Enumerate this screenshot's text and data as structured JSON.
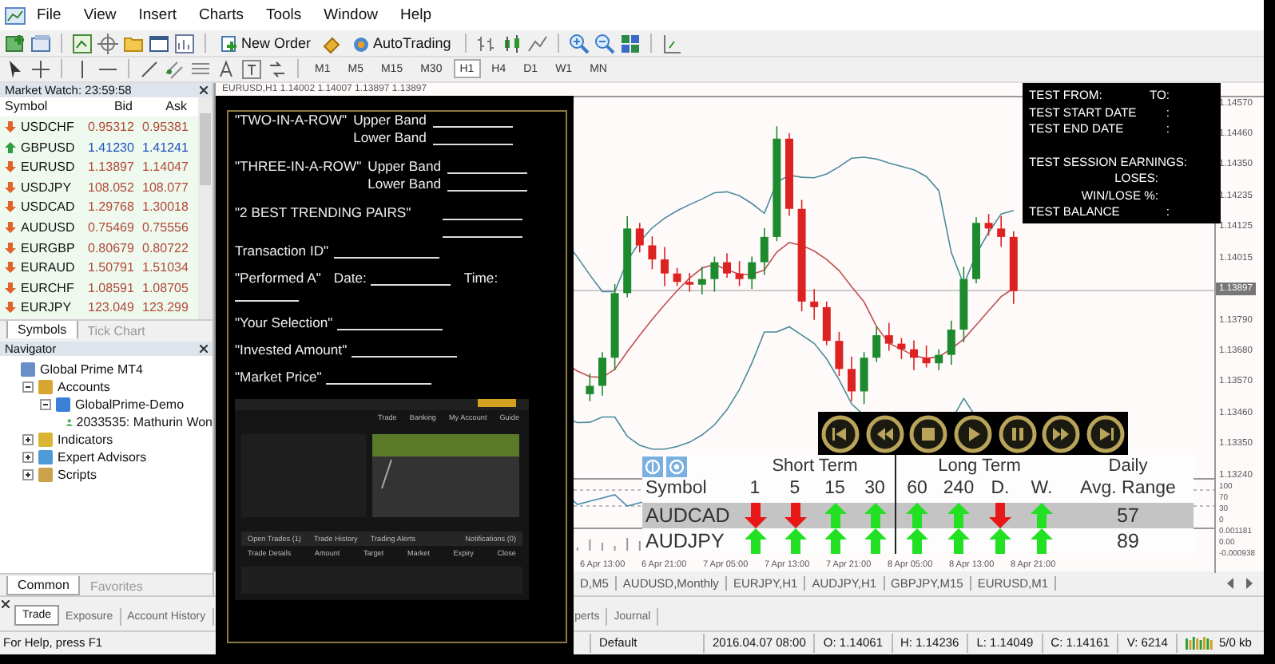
{
  "menu": {
    "items": [
      "File",
      "View",
      "Insert",
      "Charts",
      "Tools",
      "Window",
      "Help"
    ]
  },
  "toolbar": {
    "new_order": "New Order",
    "auto_trading": "AutoTrading",
    "timeframes": [
      {
        "label": "M1",
        "selected": false
      },
      {
        "label": "M5",
        "selected": false
      },
      {
        "label": "M15",
        "selected": false
      },
      {
        "label": "M30",
        "selected": false
      },
      {
        "label": "H1",
        "selected": true
      },
      {
        "label": "H4",
        "selected": false
      },
      {
        "label": "D1",
        "selected": false
      },
      {
        "label": "W1",
        "selected": false
      },
      {
        "label": "MN",
        "selected": false
      }
    ]
  },
  "market_watch": {
    "title": "Market Watch: 23:59:58",
    "columns": [
      "Symbol",
      "Bid",
      "Ask"
    ],
    "rows": [
      {
        "symbol": "USDCHF",
        "bid": "0.95312",
        "ask": "0.95381",
        "rising": false
      },
      {
        "symbol": "GBPUSD",
        "bid": "1.41230",
        "ask": "1.41241",
        "rising": true
      },
      {
        "symbol": "EURUSD",
        "bid": "1.13897",
        "ask": "1.14047",
        "rising": false
      },
      {
        "symbol": "USDJPY",
        "bid": "108.052",
        "ask": "108.077",
        "rising": false
      },
      {
        "symbol": "USDCAD",
        "bid": "1.29768",
        "ask": "1.30018",
        "rising": false
      },
      {
        "symbol": "AUDUSD",
        "bid": "0.75469",
        "ask": "0.75556",
        "rising": false
      },
      {
        "symbol": "EURGBP",
        "bid": "0.80679",
        "ask": "0.80722",
        "rising": false
      },
      {
        "symbol": "EURAUD",
        "bid": "1.50791",
        "ask": "1.51034",
        "rising": false
      },
      {
        "symbol": "EURCHF",
        "bid": "1.08591",
        "ask": "1.08705",
        "rising": false
      },
      {
        "symbol": "EURJPY",
        "bid": "123.049",
        "ask": "123.299",
        "rising": false
      }
    ],
    "tabs": [
      {
        "label": "Symbols",
        "selected": true
      },
      {
        "label": "Tick Chart",
        "selected": false
      }
    ]
  },
  "navigator": {
    "title": "Navigator",
    "tree": [
      {
        "label": "Global Prime MT4",
        "kind": "root",
        "children": [
          {
            "label": "Accounts",
            "kind": "accounts",
            "expanded": true,
            "children": [
              {
                "label": "GlobalPrime-Demo",
                "kind": "server",
                "expanded": true,
                "children": [
                  {
                    "label": "2033535: Mathurin Won",
                    "kind": "account"
                  }
                ]
              }
            ]
          },
          {
            "label": "Indicators",
            "kind": "indicators",
            "expanded": false
          },
          {
            "label": "Expert Advisors",
            "kind": "experts",
            "expanded": false
          },
          {
            "label": "Scripts",
            "kind": "scripts",
            "expanded": false
          }
        ]
      }
    ],
    "tabs": [
      {
        "label": "Common",
        "selected": true
      },
      {
        "label": "Favorites",
        "selected": false
      }
    ]
  },
  "chart": {
    "title": "EURUSD,H1  1.14002 1.14007 1.13897 1.13897",
    "price_labels": [
      "1.14570",
      "1.14460",
      "1.14350",
      "1.14235",
      "1.14125",
      "1.14015",
      "1.13790",
      "1.13680",
      "1.13570",
      "1.13460",
      "1.13350",
      "1.13240"
    ],
    "current_price": "1.13897",
    "indicator_labels": [
      "100",
      "70",
      "30",
      "0",
      "0.001181",
      "0.00",
      "-0.000938"
    ],
    "time_labels": [
      "6 Apr 13:00",
      "6 Apr 21:00",
      "7 Apr 05:00",
      "7 Apr 13:00",
      "7 Apr 21:00",
      "8 Apr 05:00",
      "8 Apr 13:00",
      "8 Apr 21:00"
    ]
  },
  "test_panel": {
    "rows": [
      {
        "kind": "pair",
        "label": "TEST FROM:",
        "value": "TO:"
      },
      {
        "kind": "pair",
        "label": "TEST START DATE",
        "value": ":"
      },
      {
        "kind": "pair",
        "label": "TEST END DATE",
        "value": ":"
      },
      {
        "kind": "left",
        "label": "TEST SESSION EARNINGS:"
      },
      {
        "kind": "right",
        "label": "LOSES:"
      },
      {
        "kind": "right",
        "label": "WIN/LOSE %:"
      },
      {
        "kind": "pair",
        "label": "TEST BALANCE",
        "value": ":"
      }
    ]
  },
  "player": {
    "buttons": [
      {
        "kind": "first"
      },
      {
        "kind": "rewind"
      },
      {
        "kind": "stop"
      },
      {
        "kind": "play"
      },
      {
        "kind": "pause"
      },
      {
        "kind": "forward"
      },
      {
        "kind": "last"
      }
    ]
  },
  "trend_table": {
    "groups": [
      "Short Term",
      "Long Term",
      "Daily"
    ],
    "columns": [
      "Symbol",
      "1",
      "5",
      "15",
      "30",
      "60",
      "240",
      "D.",
      "W.",
      "Avg. Range"
    ],
    "rows": [
      {
        "symbol": "AUDCAD",
        "signals": [
          {
            "rising": false
          },
          {
            "rising": false
          },
          {
            "rising": true
          },
          {
            "rising": true
          },
          {
            "rising": true
          },
          {
            "rising": true
          },
          {
            "rising": false
          },
          {
            "rising": true
          }
        ],
        "range": "57",
        "selected": true
      },
      {
        "symbol": "AUDJPY",
        "signals": [
          {
            "rising": true
          },
          {
            "rising": true
          },
          {
            "rising": true
          },
          {
            "rising": true
          },
          {
            "rising": true
          },
          {
            "rising": true
          },
          {
            "rising": true
          },
          {
            "rising": true
          }
        ],
        "range": "89",
        "selected": false
      }
    ]
  },
  "chart_tabs": [
    "D,M5",
    "AUDUSD,Monthly",
    "EURJPY,H1",
    "AUDJPY,H1",
    "GBPJPY,M15",
    "EURUSD,M1"
  ],
  "form": {
    "groups": [
      {
        "kind": "bands",
        "label": "\"TWO-IN-A-ROW\"",
        "bands": [
          "Upper Band",
          "Lower Band"
        ]
      },
      {
        "kind": "bands",
        "label": "\"THREE-IN-A-ROW\"",
        "bands": [
          "Upper Band",
          "Lower Band"
        ]
      },
      {
        "kind": "pairs",
        "label": "\"2 BEST TRENDING PAIRS\""
      },
      {
        "kind": "blank",
        "label": "Transaction ID\""
      },
      {
        "kind": "datetime",
        "label": "\"Performed A\"",
        "date": "Date:",
        "time": "Time:"
      },
      {
        "kind": "blank",
        "label": "\"Your Selection\""
      },
      {
        "kind": "blank",
        "label": "\"Invested Amount\""
      },
      {
        "kind": "blank",
        "label": "\"Market Price\""
      }
    ],
    "screenshot": {
      "menu": [
        "Trade",
        "Banking",
        "My Account",
        "Guide"
      ],
      "tabs": [
        "Open Trades (1)",
        "Trade History",
        "Trading Alerts"
      ],
      "notifications": "Notifications (0)",
      "columns": [
        "Trade Details",
        "Amount",
        "Target",
        "Market",
        "Expiry",
        "Close"
      ]
    }
  },
  "terminal": {
    "tabs": [
      {
        "label": "Trade",
        "selected": true
      },
      {
        "label": "Exposure",
        "selected": false
      },
      {
        "label": "Account History",
        "selected": false
      },
      {
        "label": "perts",
        "selected": false
      },
      {
        "label": "Journal",
        "selected": false
      }
    ]
  },
  "status_bar": {
    "help": "For Help, press F1",
    "profile": "Default",
    "cells": [
      "2016.04.07 08:00",
      "O: 1.14061",
      "H: 1.14236",
      "L: 1.14049",
      "C: 1.14161",
      "V: 6214"
    ],
    "traffic": "5/0 kb"
  }
}
